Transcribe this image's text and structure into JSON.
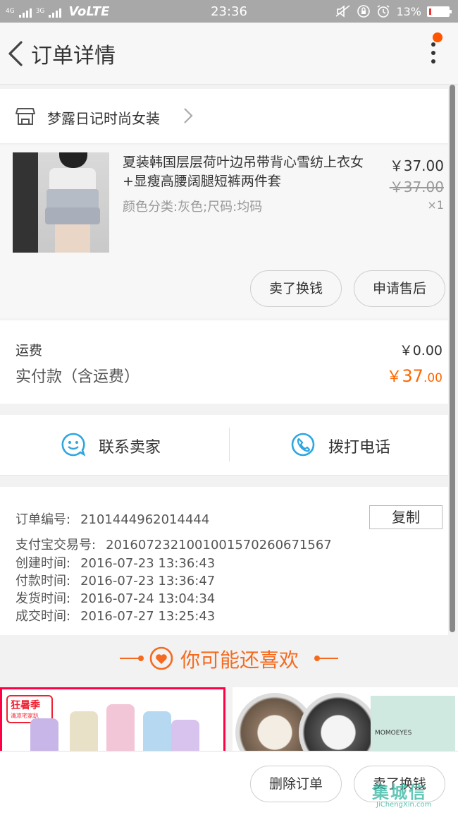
{
  "status_bar": {
    "network_small": "4G",
    "network_small2": "3G",
    "carrier_mode": "VoLTE",
    "time": "23:36",
    "battery": "13%",
    "battery_level": 0.13
  },
  "nav": {
    "title": "订单详情"
  },
  "shop": {
    "name": "梦露日记时尚女装"
  },
  "item": {
    "title": "夏装韩国层层荷叶边吊带背心雪纺上衣女+显瘦高腰阔腿短裤两件套",
    "spec": "颜色分类:灰色;尺码:均码",
    "price": "￥37.00",
    "original_price": "￥37.00",
    "quantity": "×1",
    "actions": [
      "卖了换钱",
      "申请售后"
    ]
  },
  "fees": {
    "shipping_label": "运费",
    "shipping_value": "￥0.00",
    "paid_label": "实付款（含运费）",
    "paid_currency": "￥",
    "paid_int": "37",
    "paid_dec": ".00"
  },
  "contact": {
    "seller": "联系卖家",
    "phone": "拨打电话"
  },
  "info": {
    "copy_label": "复制",
    "rows": [
      {
        "label": "订单编号:",
        "value": "2101444962014444"
      },
      {
        "label": "支付宝交易号:",
        "value": "2016072321001001570260671567"
      },
      {
        "label": "创建时间:",
        "value": "2016-07-23 13:36:43"
      },
      {
        "label": "付款时间:",
        "value": "2016-07-23 13:36:47"
      },
      {
        "label": "发货时间:",
        "value": "2016-07-24 13:04:34"
      },
      {
        "label": "成交时间:",
        "value": "2016-07-27 13:25:43"
      }
    ]
  },
  "recommend": {
    "title": "你可能还喜欢",
    "item1_badge": "狂暑季",
    "item1_sub": "清凉宅家趴",
    "item2_brand": "MOMOEYES"
  },
  "bottom_bar": {
    "delete": "删除订单",
    "sell": "卖了换钱"
  },
  "watermark": {
    "logo": "集城信",
    "url": "JiChengXin.com"
  },
  "colors": {
    "accent": "#f56a1e",
    "price_orange": "#ff6600",
    "icon_blue": "#2fa6e0",
    "status_bar": "#a8a8a8"
  }
}
